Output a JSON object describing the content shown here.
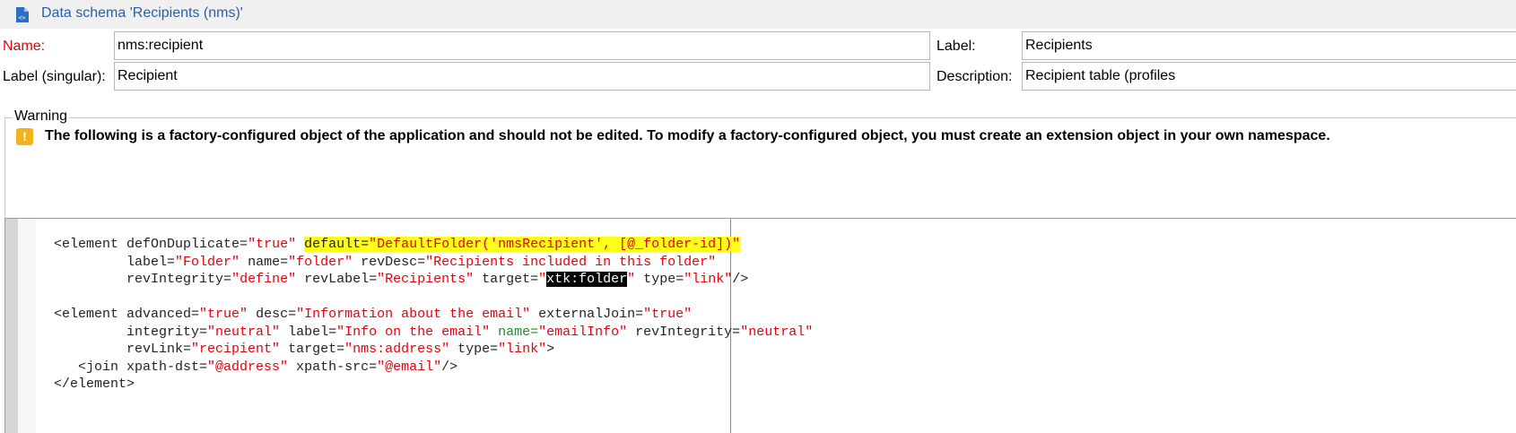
{
  "window": {
    "title": "Data schema 'Recipients (nms)'",
    "title_icon": "schema-document-icon"
  },
  "form": {
    "name_label": "Name:",
    "name_value": "nms:recipient",
    "label_label": "Label:",
    "label_value": "Recipients",
    "label_singular_label": "Label (singular):",
    "label_singular_value": "Recipient",
    "description_label": "Description:",
    "description_value": "Recipient table (profiles"
  },
  "warning": {
    "legend": "Warning",
    "icon": "warning-icon",
    "message": "The following is a factory-configured object of the application and should not be edited. To modify a factory-configured object, you must create an extension object in your own namespace."
  },
  "editor": {
    "l1": {
      "indent": "      ",
      "tag": "<element ",
      "a1": "defOnDuplicate=",
      "v1": "\"true\"",
      "sp": " ",
      "a2": "default=",
      "v2": "\"DefaultFolder('nmsRecipient', [@_folder-id])\""
    },
    "l2": {
      "indent": "               ",
      "a1": "label=",
      "v1": "\"Folder\"",
      "a2": " name=",
      "v2": "\"folder\"",
      "a3": " revDesc=",
      "v3": "\"Recipients included in this folder\""
    },
    "l3": {
      "indent": "               ",
      "a1": "revIntegrity=",
      "v1": "\"define\"",
      "a2": " revLabel=",
      "v2": "\"Recipients\"",
      "a3": " target=",
      "q1": "\"",
      "sel": "xtk:folder",
      "q2": "\"",
      "a4": " type=",
      "v4": "\"link\"",
      "end": "/>"
    },
    "l5": {
      "indent": "      ",
      "tag": "<element ",
      "a1": "advanced=",
      "v1": "\"true\"",
      "a2": " desc=",
      "v2": "\"Information about the email\"",
      "a3": " externalJoin=",
      "v3": "\"true\""
    },
    "l6": {
      "indent": "               ",
      "a1": "integrity=",
      "v1": "\"neutral\"",
      "a2": " label=",
      "v2": "\"Info on the email\"",
      "a3": " name=",
      "v3": "\"emailInfo\"",
      "a4": " revIntegrity=",
      "v4": "\"neutral\""
    },
    "l7": {
      "indent": "               ",
      "a1": "revLink=",
      "v1": "\"recipient\"",
      "a2": " target=",
      "v2": "\"nms:address\"",
      "a3": " type=",
      "v3": "\"link\"",
      "end": ">"
    },
    "l8": {
      "indent": "         ",
      "tag": "<join ",
      "a1": "xpath-dst=",
      "v1": "\"@address\"",
      "a2": " xpath-src=",
      "v2": "\"@email\"",
      "end": "/>"
    },
    "l9": {
      "indent": "      ",
      "tag": "</element>"
    }
  }
}
